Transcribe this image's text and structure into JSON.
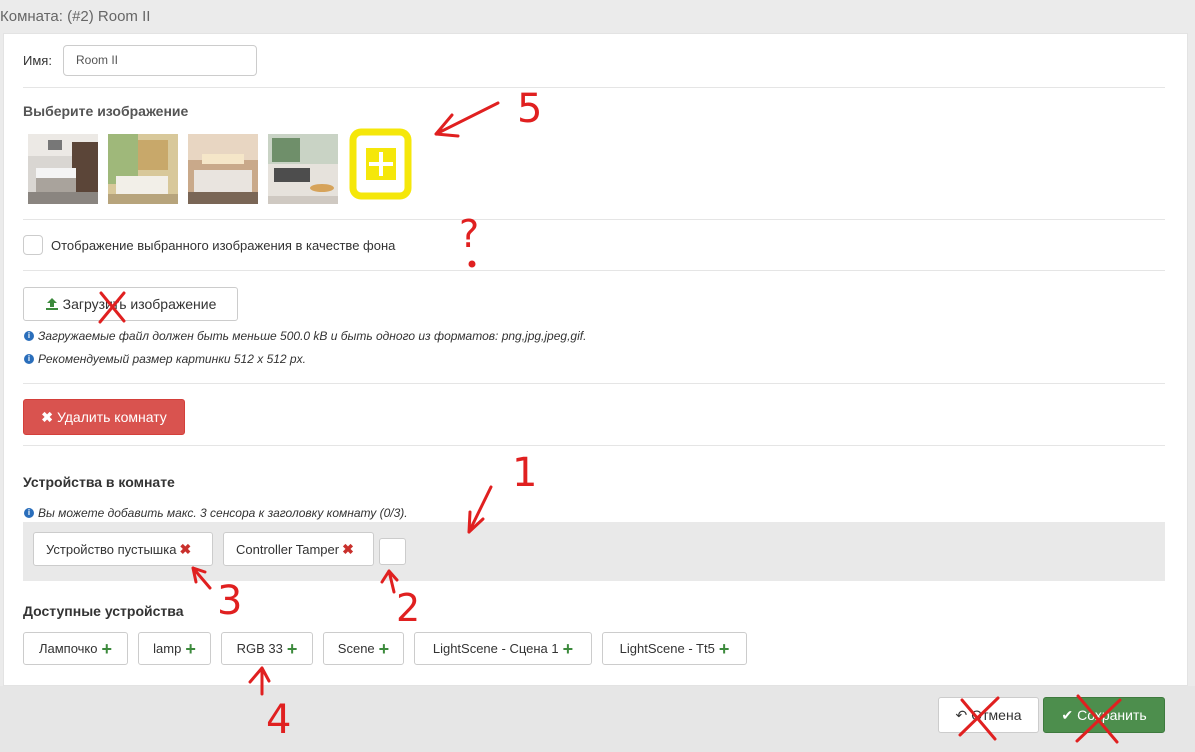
{
  "window": {
    "title": "Комната: (#2) Room II"
  },
  "form": {
    "name_label": "Имя:",
    "name_value": "Room II",
    "choose_image_heading": "Выберите изображение",
    "images": [
      {
        "icon": "kitchen-thumbnail"
      },
      {
        "icon": "bathroom-thumbnail"
      },
      {
        "icon": "bedroom-thumbnail"
      },
      {
        "icon": "living-room-thumbnail"
      }
    ],
    "bg_checkbox_label": "Отображение выбранного изображения в качестве фона",
    "bg_checkbox_checked": false,
    "upload_button_label": "Загрузить изображение",
    "upload_help_1": "Загружаемые файл должен быть меньше 500.0 kB и быть одного из форматов: png,jpg,jpeg,gif.",
    "upload_help_2": "Рекомендуемый размер картинки 512 x 512 px.",
    "delete_room_label": "Удалить комнату"
  },
  "devices_in_room": {
    "heading": "Устройства в комнате",
    "help": "Вы можете добавить макс. 3 сенсора к заголовку комнату (0/3).",
    "items": [
      {
        "label": "Устройство пустышка"
      },
      {
        "label": "Controller Tamper"
      }
    ]
  },
  "available_devices": {
    "heading": "Доступные устройства",
    "items": [
      {
        "label": "Лампочко"
      },
      {
        "label": "lamp"
      },
      {
        "label": "RGB 33"
      },
      {
        "label": "Scene"
      },
      {
        "label": "LightScene - Сцена 1"
      },
      {
        "label": "LightScene - Tt5"
      }
    ]
  },
  "footer": {
    "cancel_label": "Отмена",
    "save_label": "Сохранить"
  },
  "annotations": {
    "numbers": [
      "5",
      "?",
      "1",
      "2",
      "3",
      "4"
    ],
    "colors": {
      "ink": "#e02020",
      "highlight": "#f5e70a"
    }
  },
  "colors": {
    "danger": "#d9534f",
    "success": "#4d8e4d",
    "info": "#2a6ebb"
  }
}
